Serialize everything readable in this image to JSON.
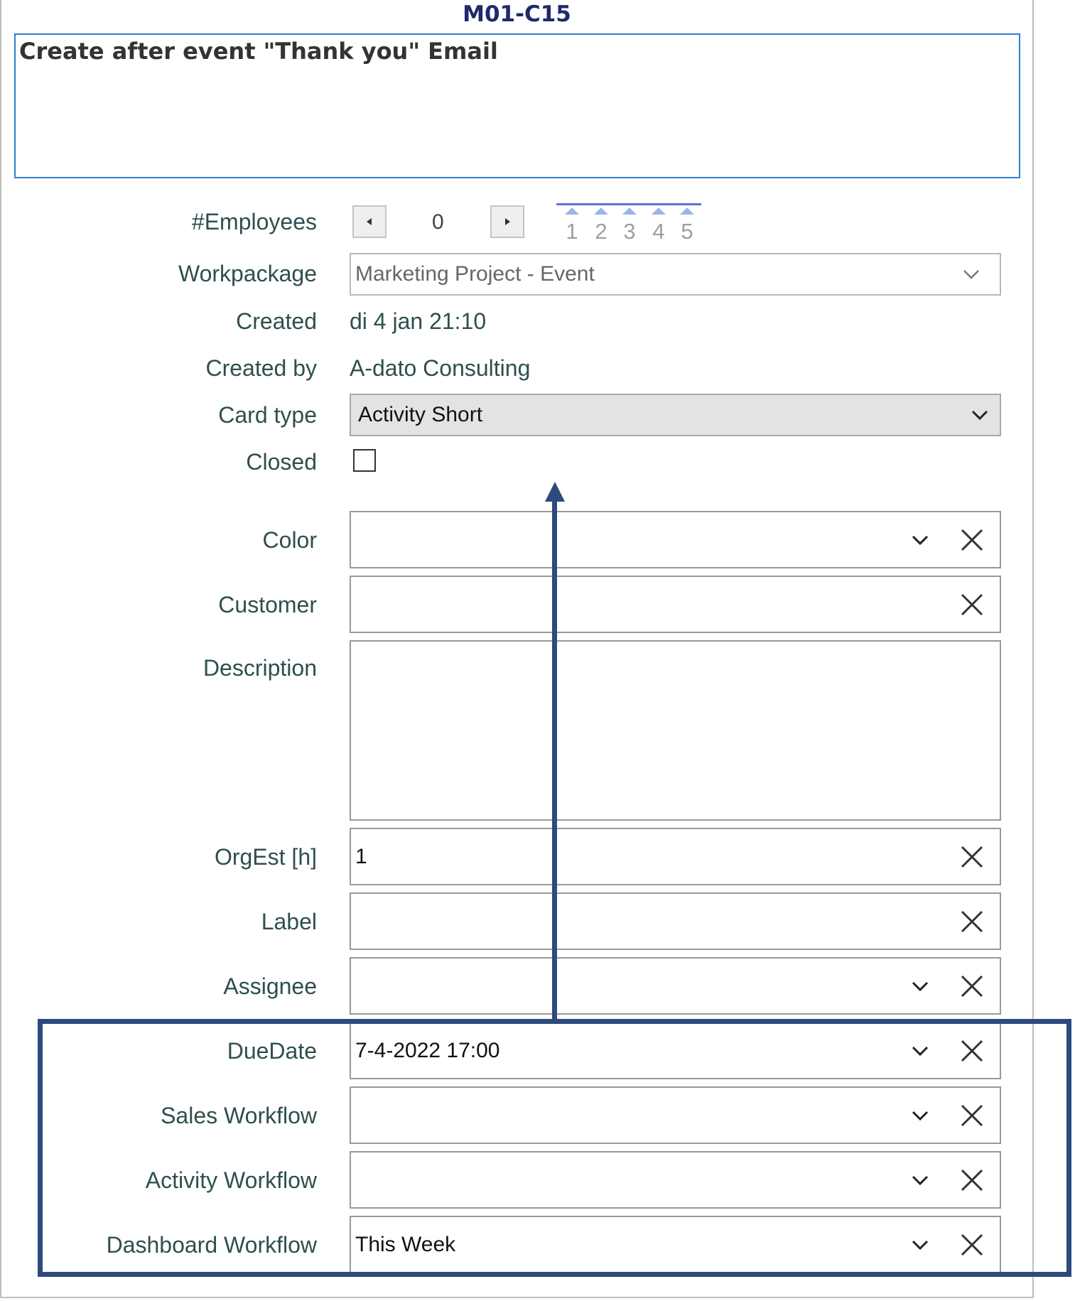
{
  "card": {
    "id": "M01-C15",
    "title": "Create after event \"Thank you\" Email"
  },
  "employees": {
    "label": "#Employees",
    "value": "0",
    "rating": [
      "1",
      "2",
      "3",
      "4",
      "5"
    ]
  },
  "workpackage": {
    "label": "Workpackage",
    "value": "Marketing Project  - Event"
  },
  "created": {
    "label": "Created",
    "value": "di 4 jan 21:10"
  },
  "created_by": {
    "label": "Created by",
    "value": "A-dato Consulting"
  },
  "card_type": {
    "label": "Card type",
    "value": "Activity  Short"
  },
  "closed": {
    "label": "Closed",
    "checked": false
  },
  "color": {
    "label": "Color",
    "value": ""
  },
  "customer": {
    "label": "Customer",
    "value": ""
  },
  "description": {
    "label": "Description",
    "value": ""
  },
  "orgest": {
    "label": "OrgEst [h]",
    "value": "1"
  },
  "label_field": {
    "label": "Label",
    "value": ""
  },
  "assignee": {
    "label": "Assignee",
    "value": ""
  },
  "due_date": {
    "label": "DueDate",
    "value": "7-4-2022 17:00"
  },
  "sales_workflow": {
    "label": "Sales Workflow",
    "value": ""
  },
  "activity_workflow": {
    "label": "Activity Workflow",
    "value": ""
  },
  "dashboard_workflow": {
    "label": "Dashboard Workflow",
    "value": "This Week"
  },
  "colors": {
    "accent": "#2f7fd3",
    "title_id": "#1f2a6b",
    "highlight": "#2e4a7d",
    "label_text": "#2f4f4f"
  }
}
